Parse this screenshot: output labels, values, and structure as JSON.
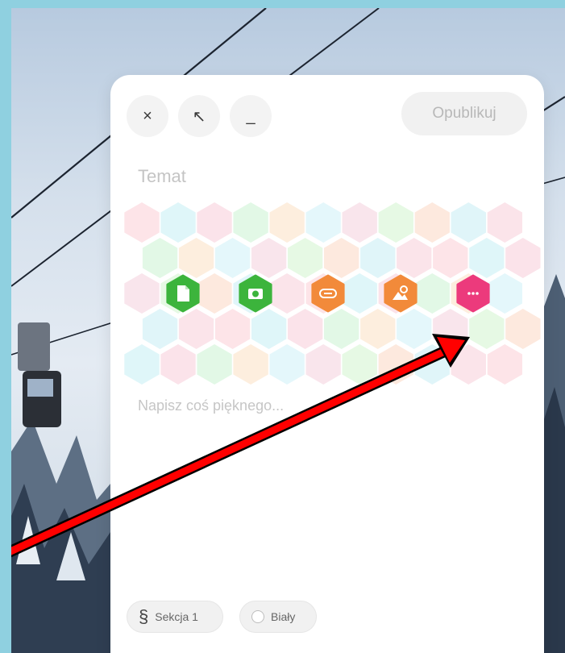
{
  "toolbar": {
    "close_glyph": "×",
    "expand_glyph": "↖",
    "minimize_glyph": "_",
    "publish_label": "Opublikuj"
  },
  "editor": {
    "subject_placeholder": "Temat",
    "body_placeholder": "Napisz coś pięknego..."
  },
  "media_actions": [
    {
      "icon": "document-icon",
      "color": "#3cb43c"
    },
    {
      "icon": "camera-icon",
      "color": "#3cb43c"
    },
    {
      "icon": "link-icon",
      "color": "#f28a3a"
    },
    {
      "icon": "image-search-icon",
      "color": "#f28a3a"
    },
    {
      "icon": "more-icon",
      "color": "#ec3a7c"
    }
  ],
  "footer": {
    "section_glyph": "§",
    "section_label": "Sekcja 1",
    "color_label": "Biały"
  },
  "annotation": {
    "arrow_color": "#ff0000"
  }
}
